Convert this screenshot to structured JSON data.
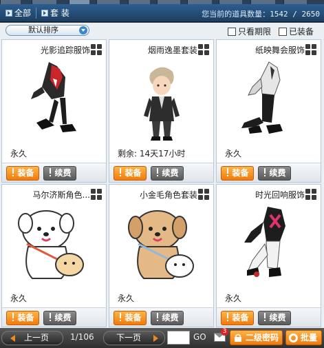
{
  "header": {
    "subtabs": [
      "全部",
      "套 装"
    ],
    "item_count_label": "您当前的道具数量：",
    "item_count_value": "1542 / 2650"
  },
  "filters": {
    "sort_label": "默认排序",
    "only_expiring": "只看期限",
    "equipped": "已装备"
  },
  "items": [
    {
      "name": "光影追踪服饰",
      "status": "永久"
    },
    {
      "name": "烟雨逸墨套装",
      "status": "剩余: 14天17小时"
    },
    {
      "name": "纸映舞会服饰",
      "status": "永久"
    },
    {
      "name": "马尔济斯角色...",
      "status": "永久"
    },
    {
      "name": "小金毛角色套装",
      "status": "永久"
    },
    {
      "name": "时光回响服饰",
      "status": "永久"
    }
  ],
  "card_buttons": {
    "equip": "装备",
    "renew": "续费"
  },
  "pagination": {
    "prev": "上一页",
    "page": "1/106",
    "next": "下一页",
    "go": "GO"
  },
  "footer": {
    "mail_badge": "3",
    "second_password": "二级密码",
    "batch": "批量"
  },
  "colors": {
    "header": "#2d5e8e",
    "equip_button": "#f07a0c",
    "renew_button": "#5a5a5a",
    "panel_bg": "#eaeff4"
  }
}
